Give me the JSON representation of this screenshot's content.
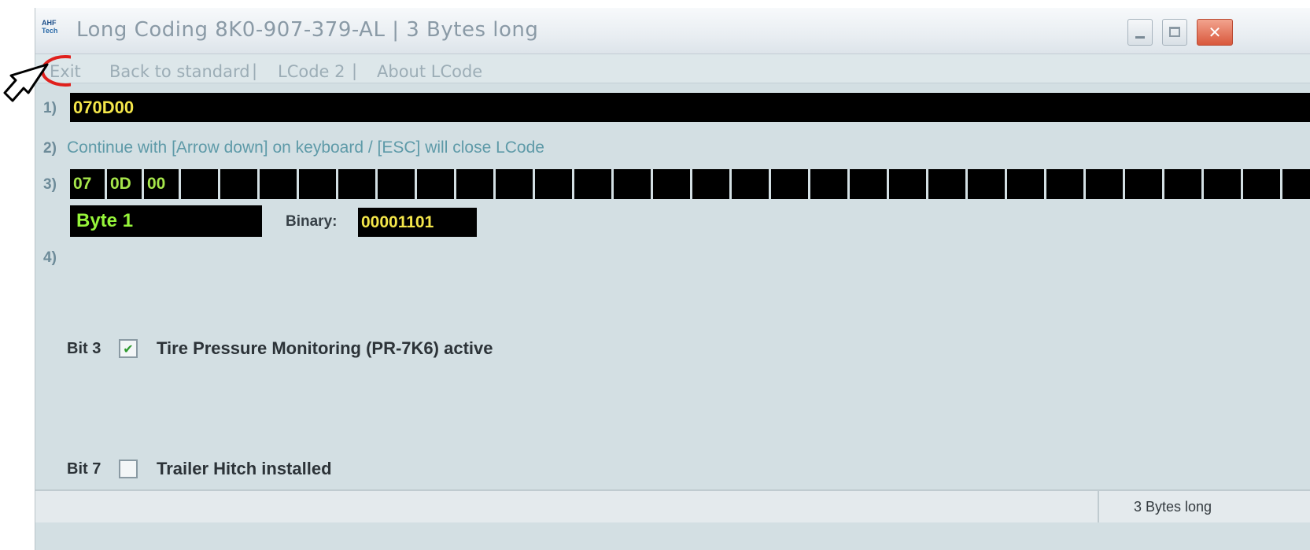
{
  "window": {
    "title": "Long Coding  8K0-907-379-AL  |  3 Bytes long",
    "app_icon_lines": [
      "AHF",
      "Tech"
    ],
    "controls": {
      "minimize": "_",
      "maximize": "□",
      "close": "✕"
    }
  },
  "menu": {
    "items": [
      "Exit",
      "Back to standard",
      "LCode 2",
      "About LCode"
    ],
    "separators": [
      "|",
      "|",
      "|"
    ],
    "highlighted_item": "Exit",
    "highlight_color": "#e0201c"
  },
  "rows": {
    "row1_label": "1)",
    "code_value": "070D00",
    "row2_label": "2)",
    "hint": "Continue with [Arrow down] on keyboard / [ESC] will close LCode",
    "row3_label": "3)",
    "bytes": [
      "07",
      "0D",
      "00",
      "",
      "",
      "",
      "",
      "",
      "",
      "",
      "",
      "",
      "",
      "",
      "",
      "",
      "",
      "",
      "",
      "",
      "",
      "",
      "",
      "",
      "",
      "",
      "",
      "",
      "",
      "",
      "",
      ""
    ],
    "byte_label": "Byte 1",
    "binary_label": "Binary:",
    "binary_value": "00001101",
    "row4_label": "4)"
  },
  "bits": [
    {
      "label": "Bit 3",
      "checked": true,
      "text": "Tire Pressure Monitoring (PR-7K6) active"
    },
    {
      "label": "Bit 7",
      "checked": false,
      "text": "Trailer Hitch installed"
    }
  ],
  "status": {
    "text": "3 Bytes long"
  },
  "colors": {
    "code_text": "#f4e64a",
    "byte_text": "#a6e64a",
    "window_bg": "#d3dfe3"
  }
}
